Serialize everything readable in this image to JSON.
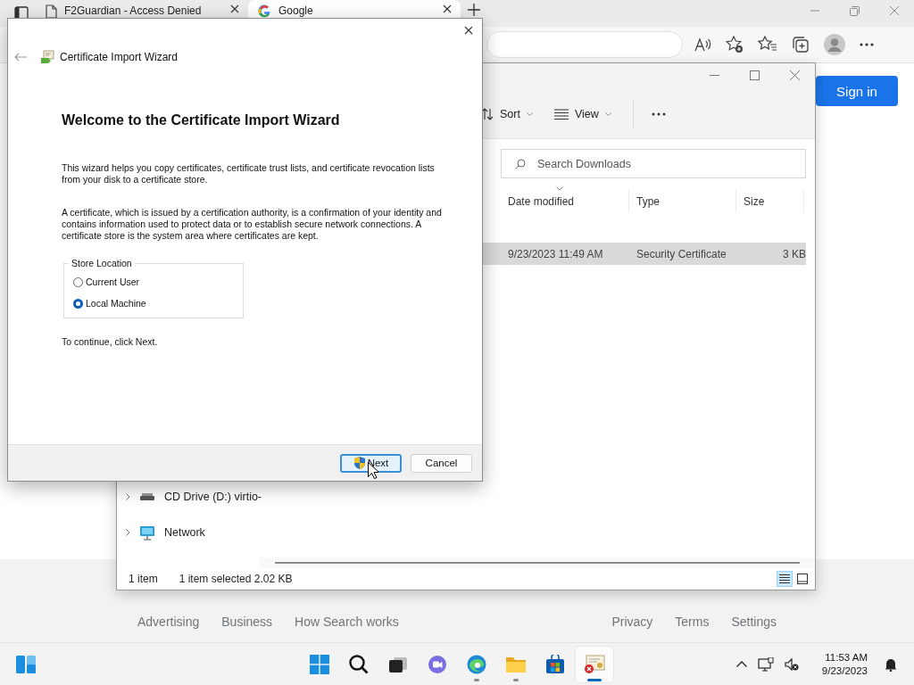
{
  "browser": {
    "tabs": [
      {
        "title": "F2Guardian - Access Denied",
        "kind": "page",
        "selected": false
      },
      {
        "title": "Google",
        "kind": "site",
        "selected": true
      }
    ],
    "sign_in": "Sign in",
    "footer_left": [
      "Advertising",
      "Business",
      "How Search works"
    ],
    "footer_right": [
      "Privacy",
      "Terms",
      "Settings"
    ]
  },
  "explorer": {
    "toolbar": [
      {
        "label": "Sort",
        "kind": "sort"
      },
      {
        "label": "View",
        "kind": "view"
      }
    ],
    "search": {
      "placeholder": "Search Downloads"
    },
    "columns": [
      "Date modified",
      "Type",
      "Size"
    ],
    "rows": [
      {
        "cells": [
          "9/23/2023 11:49 AM",
          "Security Certificate",
          "3 KB"
        ],
        "selected": true
      }
    ],
    "nav": [
      {
        "label": "CD Drive (D:) virtio-",
        "kind": "drive"
      },
      {
        "label": "Network",
        "kind": "network"
      }
    ],
    "status": [
      "1 item",
      "1 item selected  2.02 KB"
    ],
    "view_modes": [
      {
        "kind": "details",
        "selected": true
      },
      {
        "kind": "tiles",
        "selected": false
      }
    ]
  },
  "wizard": {
    "title": "Certificate Import Wizard",
    "heading": "Welcome to the Certificate Import Wizard",
    "paragraphs": [
      "This wizard helps you copy certificates, certificate trust lists, and certificate revocation lists from your disk to a certificate store.",
      "A certificate, which is issued by a certification authority, is a confirmation of your identity and contains information used to protect data or to establish secure network connections. A certificate store is the system area where certificates are kept."
    ],
    "store_location": {
      "label": "Store Location",
      "options": [
        {
          "label": "Current User",
          "selected": false
        },
        {
          "label": "Local Machine",
          "selected": true
        }
      ]
    },
    "hint": "To continue, click Next.",
    "buttons": [
      {
        "label": "Next",
        "kind": "elevated",
        "default": true
      },
      {
        "label": "Cancel",
        "kind": "plain",
        "default": false
      }
    ]
  },
  "taskbar": {
    "apps": [
      {
        "kind": "start",
        "running": false,
        "selected": false
      },
      {
        "kind": "search",
        "running": false,
        "selected": false
      },
      {
        "kind": "taskview",
        "running": false,
        "selected": false
      },
      {
        "kind": "chat",
        "running": false,
        "selected": false
      },
      {
        "kind": "browser",
        "running": true,
        "selected": false
      },
      {
        "kind": "folder",
        "running": true,
        "selected": false
      },
      {
        "kind": "store",
        "running": false,
        "selected": false
      },
      {
        "kind": "certificate",
        "running": true,
        "selected": true
      }
    ],
    "time": "11:53 AM",
    "date": "9/23/2023"
  }
}
